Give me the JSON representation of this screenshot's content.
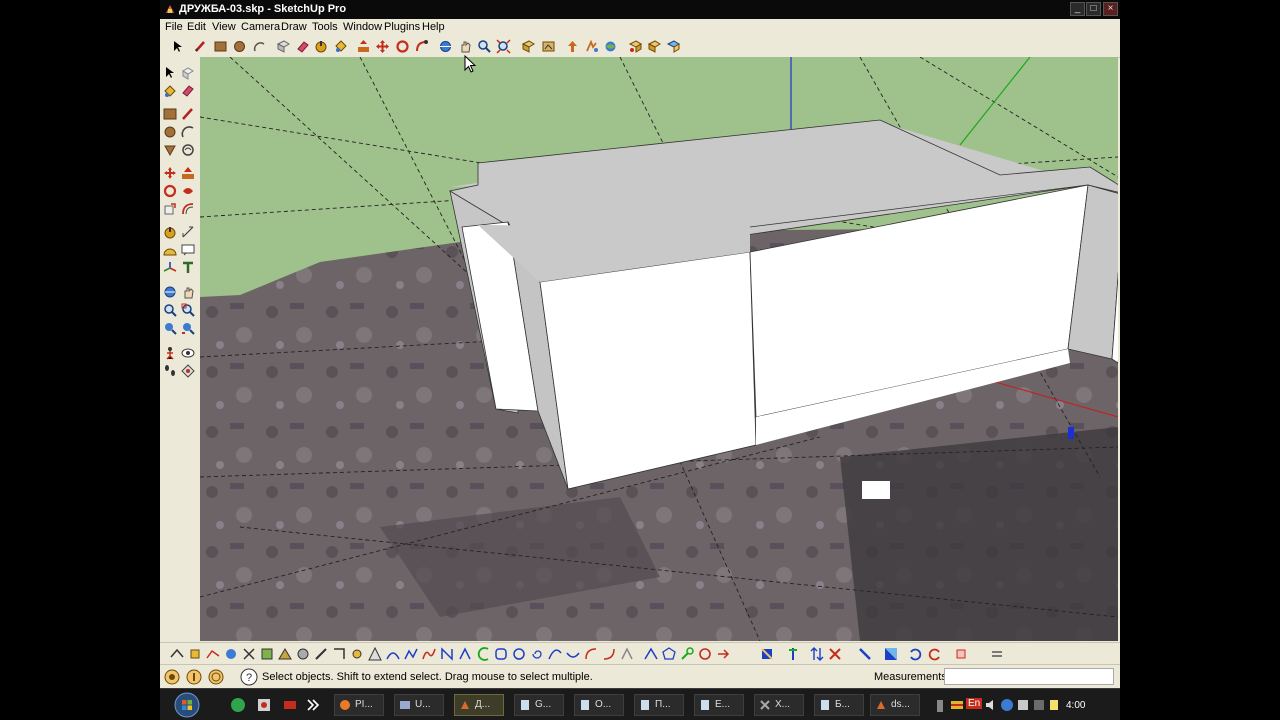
{
  "window": {
    "title": "ДРУЖБА-03.skp - SketchUp Pro",
    "controls": [
      "_",
      "□",
      "×"
    ]
  },
  "menu": [
    "File",
    "Edit",
    "View",
    "Camera",
    "Draw",
    "Tools",
    "Window",
    "Plugins",
    "Help"
  ],
  "top_toolbar_icons": [
    "select-icon",
    "pencil-icon",
    "rectangle-icon",
    "circle-icon",
    "arc-icon",
    "make-component-icon",
    "eraser-icon",
    "tape-measure-icon",
    "paint-bucket-icon",
    "push-pull-icon",
    "move-icon",
    "rotate-icon",
    "follow-me-icon",
    "orbit-icon",
    "pan-icon",
    "zoom-icon",
    "zoom-extents-icon",
    "previous-view-icon",
    "walk-icon",
    "look-around-icon",
    "position-camera-icon",
    "get-models-icon",
    "share-model-icon",
    "send-to-layout-icon"
  ],
  "left_toolbar_icons": [
    "select-icon",
    "make-component-icon",
    "paint-bucket-icon",
    "eraser-icon",
    "rectangle-icon",
    "line-icon",
    "circle-icon",
    "arc-icon",
    "polygon-icon",
    "freehand-icon",
    "move-icon",
    "push-pull-icon",
    "rotate-icon",
    "follow-me-icon",
    "scale-icon",
    "offset-icon",
    "tape-measure-icon",
    "dimension-icon",
    "protractor-icon",
    "text-icon",
    "axes-icon",
    "3d-text-icon",
    "orbit-icon",
    "pan-icon",
    "zoom-icon",
    "zoom-window-icon",
    "zoom-extents-icon",
    "previous-icon",
    "position-camera-icon",
    "look-around-icon",
    "walk-icon",
    "section-plane-icon"
  ],
  "bottom_toolbar_icon_count": 48,
  "status": {
    "help_text": "Select objects. Shift to extend select. Drag mouse to select multiple.",
    "measurements_label": "Measurements",
    "measurements_value": ""
  },
  "taskbar": {
    "tasks": [
      "PI...",
      "U...",
      "Д...",
      "G...",
      "O...",
      "П...",
      "E...",
      "X...",
      "Б...",
      "ds..."
    ],
    "language": "En",
    "clock": "4:00"
  },
  "colors": {
    "sky_ground": "#9fc18c",
    "building_face": "#ffffff",
    "building_top": "#c9c9c9",
    "terrain": "#6e6468",
    "taskbar": "#1b1b1b"
  }
}
